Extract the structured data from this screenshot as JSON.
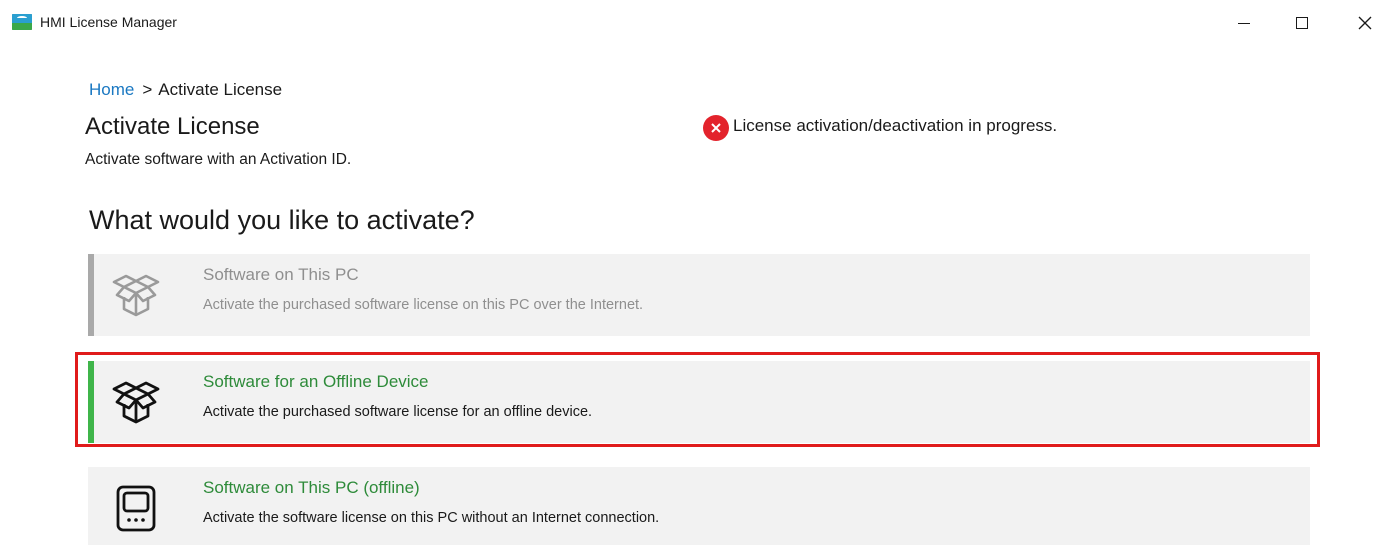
{
  "window": {
    "title": "HMI License Manager",
    "icons": {
      "app": "app-logo-icon",
      "minimize": "minimize-icon",
      "maximize": "maximize-icon",
      "close": "close-icon"
    }
  },
  "breadcrumb": {
    "home": "Home",
    "separator": ">",
    "current": "Activate License"
  },
  "page": {
    "title": "Activate License",
    "subtitle": "Activate software with an Activation ID."
  },
  "status": {
    "icon": "error-icon",
    "text": "License activation/deactivation in progress.",
    "color": "#e3232c"
  },
  "section": {
    "heading": "What would you like to activate?"
  },
  "options": [
    {
      "icon": "open-box-icon",
      "title": "Software on This PC",
      "description": "Activate the purchased software license on this PC over the Internet.",
      "state": "disabled"
    },
    {
      "icon": "open-box-icon",
      "title": "Software for an Offline Device",
      "description": "Activate the purchased software license for an offline device.",
      "state": "selected"
    },
    {
      "icon": "hmi-device-icon",
      "title": "Software on This PC (offline)",
      "description": "Activate the software license on this PC without an Internet connection.",
      "state": "normal"
    }
  ],
  "colors": {
    "link": "#1a78c2",
    "accent_green": "#3fb54a",
    "option_title_green": "#2e8b3a",
    "disabled_text": "#8f8f8f",
    "highlight_border": "#e01b1b",
    "option_background": "#f2f2f2"
  }
}
